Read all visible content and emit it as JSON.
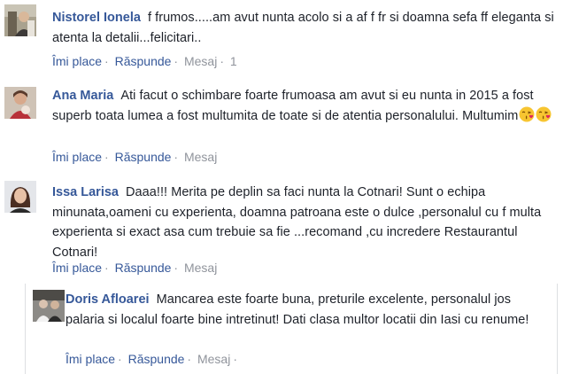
{
  "comments": [
    {
      "name": "Nistorel Ionela",
      "text": "f frumos.....am avut nunta acolo si a af f fr si doamna sefa ff eleganta si atenta la detalii...felicitari..",
      "actions": {
        "like": "Îmi place",
        "reply": "Răspunde",
        "message": "Mesaj",
        "time": "1"
      }
    },
    {
      "name": "Ana Maria",
      "text": "Ati facut o schimbare foarte frumoasa am avut si eu nunta in 2015 a fost superb toata lumea a fost multumita de toate si de atentia personalului. Multumim",
      "emoji": [
        "kiss-heart-emoji",
        "kiss-heart-emoji"
      ],
      "actions": {
        "like": "Îmi place",
        "reply": "Răspunde",
        "message": "Mesaj"
      }
    },
    {
      "name": "Issa Larisa",
      "text": "Daaa!!! Merita pe deplin sa faci nunta la Cotnari! Sunt o echipa minunata,oameni cu experienta, doamna patroana este o dulce ,personalul cu f multa experienta si exact asa cum trebuie sa fie ...recomand ,cu incredere Restaurantul Cotnari!",
      "actions": {
        "like": "Îmi place",
        "reply": "Răspunde",
        "message": "Mesaj"
      }
    },
    {
      "name": "Doris Afloarei",
      "text": "Mancarea este foarte buna, preturile excelente, personalul jos palaria si localul foarte bine intretinut! Dati clasa multor locatii din Iasi cu renume!",
      "actions": {
        "like": "Îmi place",
        "reply": "Răspunde",
        "message": "Mesaj"
      }
    }
  ],
  "colors": {
    "name": "#365899",
    "text": "#1d2129",
    "muted": "#90949c",
    "border": "#dddfe2"
  }
}
